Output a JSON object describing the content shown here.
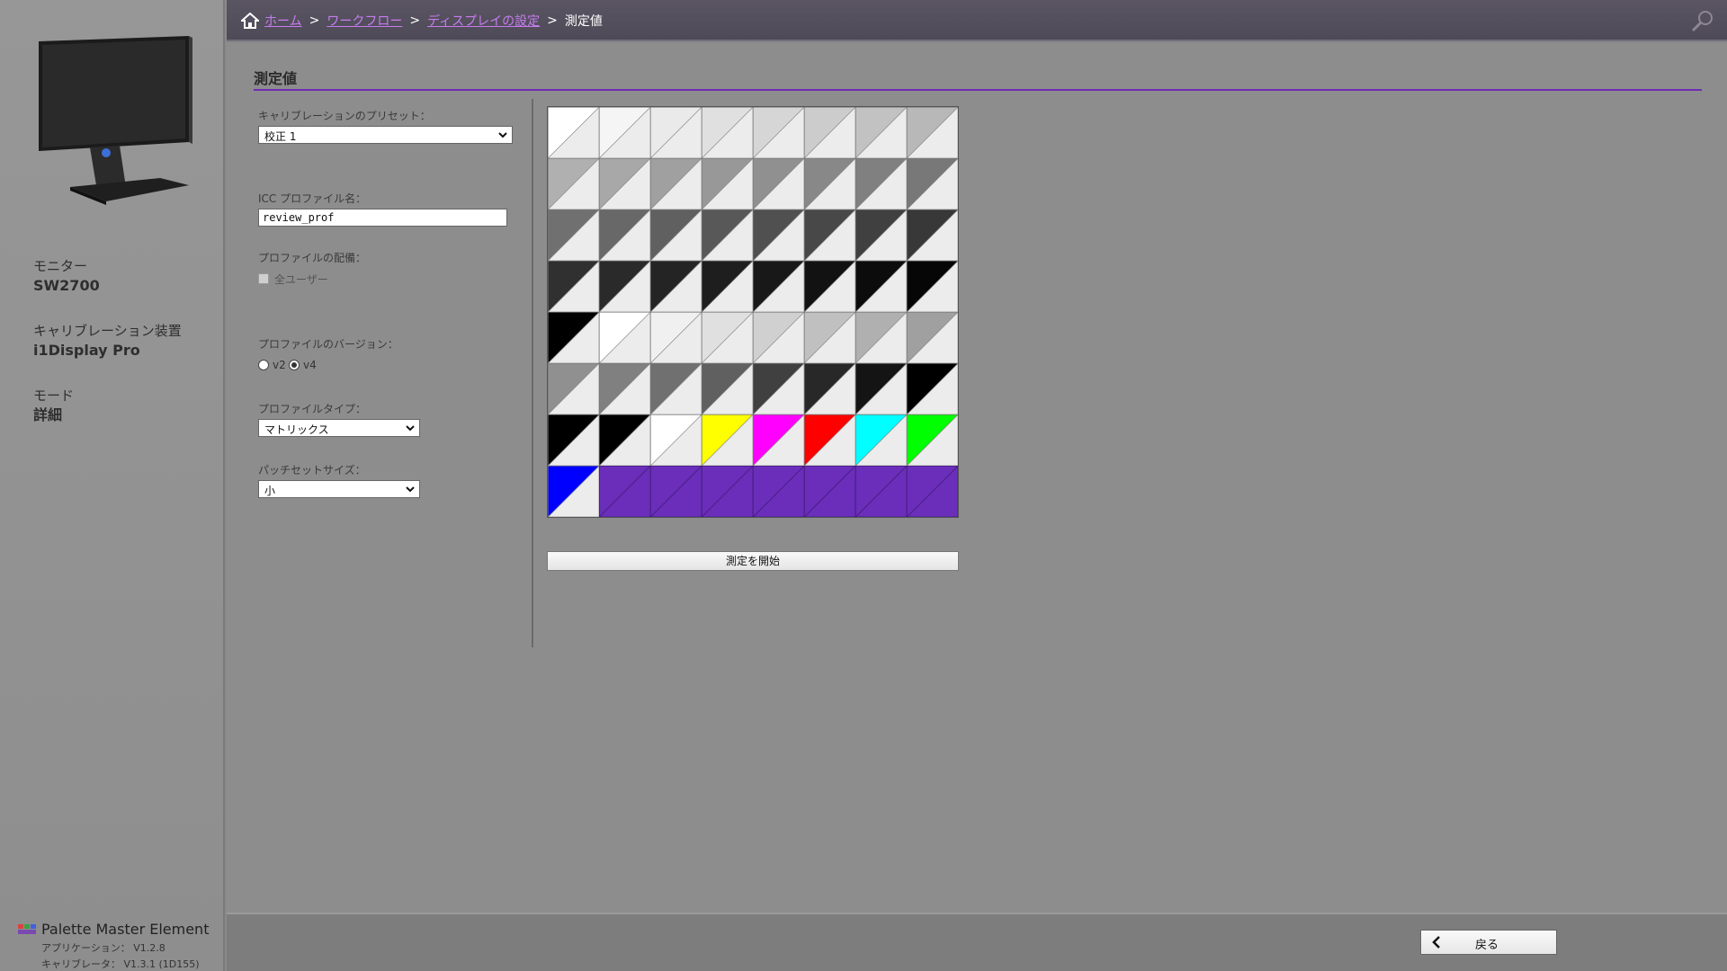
{
  "breadcrumb": {
    "home": "ホーム",
    "workflow": "ワークフロー",
    "display_settings": "ディスプレイの設定",
    "separator": ">",
    "current": "測定値"
  },
  "sidebar": {
    "monitor_label": "モニター",
    "monitor_value": "SW2700",
    "device_label": "キャリブレーション装置",
    "device_value": "i1Display Pro",
    "mode_label": "モード",
    "mode_value": "詳細"
  },
  "brand": {
    "name": "Palette Master Element",
    "app_version": "アプリケーション： V1.2.8",
    "calibrator_version": "キャリブレータ： V1.3.1 (1D155)"
  },
  "page": {
    "title": "測定値",
    "preset_label": "キャリブレーションのプリセット：",
    "preset_value": "校正 1",
    "icc_label": "ICC プロファイル名：",
    "icc_value": "review_prof",
    "distribution_label": "プロファイルの配備：",
    "all_users_label": "全ユーザー",
    "version_label": "プロファイルのバージョン：",
    "version_v2": "v2",
    "version_v4": "v4",
    "version_selected": "v4",
    "type_label": "プロファイルタイプ：",
    "type_value": "マトリックス",
    "patch_size_label": "パッチセットサイズ：",
    "patch_size_value": "小",
    "start_button": "測定を開始",
    "back_button": "戻る"
  },
  "patches": [
    [
      "#ffffff",
      "#f5f5f5",
      "#eaeaea",
      "#e0e0e0",
      "#d6d6d6",
      "#cccccc",
      "#c2c2c2",
      "#b8b8b8"
    ],
    [
      "#b0b0b0",
      "#a8a8a8",
      "#a0a0a0",
      "#989898",
      "#909090",
      "#888888",
      "#808080",
      "#787878"
    ],
    [
      "#707070",
      "#686868",
      "#606060",
      "#585858",
      "#505050",
      "#484848",
      "#404040",
      "#383838"
    ],
    [
      "#303030",
      "#2a2a2a",
      "#242424",
      "#1e1e1e",
      "#181818",
      "#121212",
      "#0c0c0c",
      "#060606"
    ],
    [
      "#000000",
      "#ffffff",
      "#f0f0f0",
      "#e0e0e0",
      "#d0d0d0",
      "#c0c0c0",
      "#b0b0b0",
      "#a0a0a0"
    ],
    [
      "#909090",
      "#808080",
      "#707070",
      "#606060",
      "#404040",
      "#282828",
      "#141414",
      "#000000"
    ],
    [
      "#000000",
      "#000000",
      "#ffffff",
      "#ffff00",
      "#ff00ff",
      "#ff0000",
      "#00ffff",
      "#00ff00"
    ],
    [
      "#0000ff",
      "#6a2eba",
      "#6a2eba",
      "#6a2eba",
      "#6a2eba",
      "#6a2eba",
      "#6a2eba",
      "#6a2eba"
    ]
  ],
  "colors": {
    "accent": "#6d2cb3",
    "link": "#c77cf0",
    "header_bg": "#544f5d",
    "patch_filler": "#6a2eba"
  }
}
